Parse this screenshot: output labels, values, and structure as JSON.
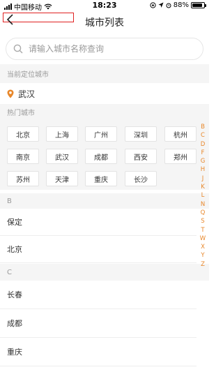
{
  "status_bar": {
    "carrier": "中国移动",
    "time": "18:23",
    "battery_percent": "88%",
    "battery_level": 0.88
  },
  "nav": {
    "title": "城市列表"
  },
  "search": {
    "placeholder": "请输入城市名称查询"
  },
  "current_location": {
    "header": "当前定位城市",
    "city": "武汉"
  },
  "hot_cities": {
    "header": "热门城市",
    "items": [
      "北京",
      "上海",
      "广州",
      "深圳",
      "杭州",
      "南京",
      "武汉",
      "成都",
      "西安",
      "郑州",
      "苏州",
      "天津",
      "重庆",
      "长沙"
    ]
  },
  "sections": [
    {
      "letter": "B",
      "cities": [
        "保定",
        "北京"
      ]
    },
    {
      "letter": "C",
      "cities": [
        "长春",
        "成都",
        "重庆"
      ]
    }
  ],
  "index_letters": [
    "B",
    "C",
    "D",
    "F",
    "G",
    "H",
    "J",
    "K",
    "L",
    "N",
    "Q",
    "S",
    "T",
    "W",
    "X",
    "Y",
    "Z"
  ],
  "colors": {
    "accent": "#e8872a",
    "highlight_border": "#e02020",
    "section_bg": "#f5f5f5"
  }
}
